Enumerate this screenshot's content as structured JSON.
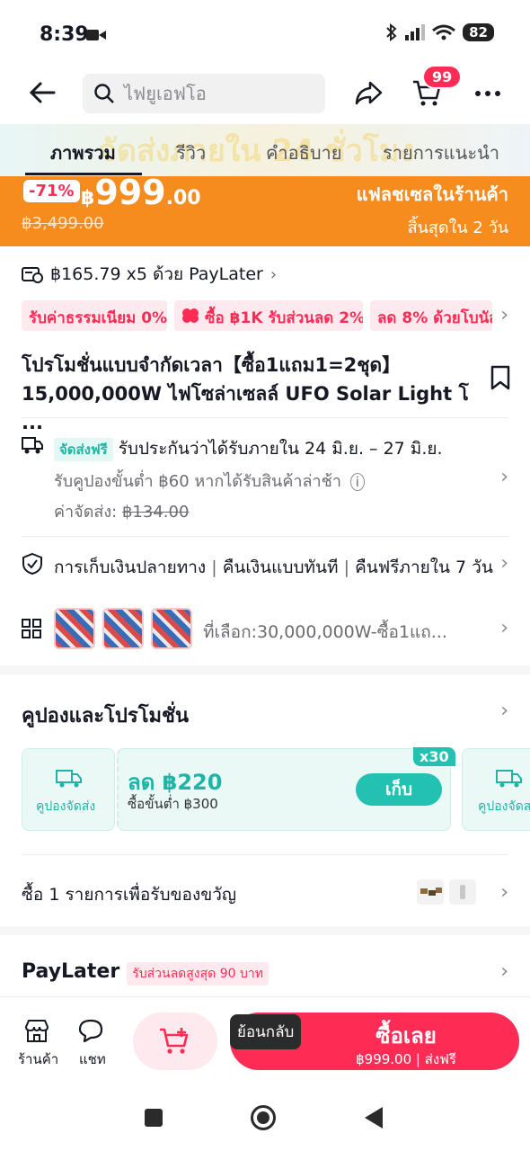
{
  "status": {
    "time": "8:39",
    "battery": "82"
  },
  "nav": {
    "search_placeholder": "ไฟยูเอฟโอ",
    "cart_badge": "99"
  },
  "tabs": [
    {
      "label": "ภาพรวม",
      "active": true
    },
    {
      "label": "รีวิว",
      "active": false
    },
    {
      "label": "คำอธิบาย",
      "active": false
    },
    {
      "label": "รายการแนะนำ",
      "active": false
    }
  ],
  "banner_bg_text": "จัดส่งภายใน 24 ชั่วโมง",
  "flash_sale": {
    "discount": "-71%",
    "currency": "฿",
    "price_int": "999",
    "price_dec": ".00",
    "original_price": "฿3,499.00",
    "title": "แฟลชเซลในร้านค้า",
    "ends_in": "สิ้นสุดใน 2 วัน"
  },
  "paylater_row": {
    "text": "฿165.79 x5 ด้วย PayLater"
  },
  "promo_chips": [
    "รับค่าธรรมเนียม 0%",
    "ซื้อ ฿1K รับส่วนลด 2%",
    "ลด 8% ด้วยโบนัส"
  ],
  "product": {
    "title_line1": "โปรโมชั่นแบบจำกัดเวลา【ซื้อ1แถม1=2ชุด】",
    "title_line2": "15,000,000W ไฟโซล่าเซลล์ UFO Solar Light โ ..."
  },
  "shipping": {
    "badge": "จัดส่งฟรี",
    "guarantee": "รับประกันว่าได้รับภายใน 24 มิ.ย. – 27 มิ.ย.",
    "late_coupon": "รับคูปองขั้นต่ำ ฿60 หากได้รับสินค้าล่าช้า",
    "fee_label": "ค่าจัดส่ง:",
    "fee_original": "฿134.00"
  },
  "services": [
    "การเก็บเงินปลายทาง",
    "คืนเงินแบบทันที",
    "คืนฟรีภายใน 7 วัน"
  ],
  "variants": {
    "selected": "ที่เลือก:30,000,000W-ซื้อ1แถ..."
  },
  "coupons": {
    "section_title": "คูปองและโปรโมชั่น",
    "ship_coupon_label": "คูปองจัดส่ง",
    "ship_coupon_label_2": "คูปองจัดส",
    "amount": "ลด ฿220",
    "min_spend": "ซื้อขั้นต่ำ ฿300",
    "collect_label": "เก็บ",
    "count": "x30"
  },
  "gift_row": {
    "text": "ซื้อ 1 รายการเพื่อรับของขวัญ"
  },
  "paylater_section": {
    "title": "PayLater",
    "badge": "รับส่วนลดสูงสุด 90 บาท"
  },
  "bottom": {
    "shop_label": "ร้านค้า",
    "chat_label": "แชท",
    "back_tooltip": "ย้อนกลับ",
    "buy_label": "ซื้อเลย",
    "buy_price": "฿999.00",
    "buy_shipping": "ส่งฟรี"
  },
  "colors": {
    "accent": "#fe2c55",
    "flash": "#f68b1e",
    "teal": "#23c1b1"
  }
}
